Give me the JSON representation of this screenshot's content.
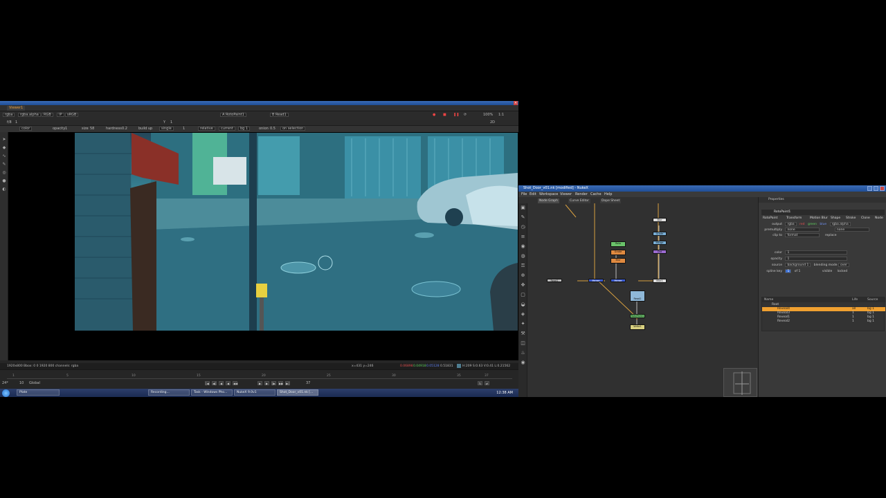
{
  "viewer_window": {
    "tab_label": "Viewer1",
    "channels": "rgba",
    "layer": "rgba.alpha",
    "colorspace": "RGB",
    "ip_label": "IP",
    "lut": "sRGB",
    "input_a": "A  RotoPaint1",
    "input_b": "B  Read1",
    "zoom": "100%",
    "proxy": "1:1",
    "view_mode": "2D",
    "frame_label": "f/8",
    "frame_value": "1",
    "y_label": "Y",
    "y_value": "1",
    "tool_options": {
      "color_label": "color",
      "opacity_label": "opacity",
      "opacity_value": "1",
      "size_label": "size",
      "size_value": "58",
      "hardness_label": "hardness",
      "hardness_value": "0.2",
      "buildup_label": "build up",
      "lifetime": "single",
      "lifetime_value": "1",
      "source_mode": "relative",
      "source": "current",
      "bg": "bg 1",
      "onion_label": "onion",
      "onion_value": "0.5",
      "selection": "on selection"
    },
    "status_left": "1920x800  Bbox: 0 0 1920 800 channels: rgba",
    "status_mid": "x=431 y=246",
    "status_red": "0.06898",
    "status_green": "0.04918",
    "status_blue": "0.05128",
    "status_alpha": "0.51831",
    "status_hsvl": "H:209 S:0.63 V:0.41  L:0.21562",
    "timeline_ticks": [
      "1",
      "5",
      "10",
      "15",
      "20",
      "25",
      "30",
      "35",
      "37"
    ],
    "fps": "24*",
    "frame_step": "10",
    "scope": "Global",
    "end_frame": "37"
  },
  "taskbar": {
    "items": [
      {
        "label": "Plate",
        "active": false
      },
      {
        "label": "Recording...",
        "active": false
      },
      {
        "label": "Task - Windows Pho...",
        "active": false
      },
      {
        "label": "NukeX 9.0v1",
        "active": false
      },
      {
        "label": "Shot_Door_v01.nk [...",
        "active": true
      }
    ],
    "clock": "12:38 AM"
  },
  "nuke_window": {
    "title": "Shot_Door_v01.nk [modified] - NukeX",
    "menu": [
      "File",
      "Edit",
      "Workspace",
      "Viewer",
      "Render",
      "Cache",
      "Help"
    ],
    "graph_tabs": [
      "Node Graph",
      "Curve Editor",
      "Dope Sheet"
    ],
    "nodes": [
      {
        "label": "Blur",
        "color": "#e0e0e0"
      },
      {
        "label": "Grade",
        "color": "#7ab0d8"
      },
      {
        "label": "Merge",
        "color": "#7ab0d8"
      },
      {
        "label": "Roto",
        "color": "#6ac26a"
      },
      {
        "label": "Grade",
        "color": "#e08a40"
      },
      {
        "label": "Blur",
        "color": "#e08a40"
      },
      {
        "label": "Dot",
        "color": "#9b6bd0"
      },
      {
        "label": "Read1",
        "color": "#bcbcbc"
      },
      {
        "label": "Merge",
        "color": "#3b5bd0"
      },
      {
        "label": "Merge",
        "color": "#3b5bd0"
      },
      {
        "label": "Blur1",
        "color": "#e0e0e0"
      },
      {
        "label": "Read2",
        "color": "#8fb8d8"
      },
      {
        "label": "RotoPaint1",
        "color": "#6ac26a"
      },
      {
        "label": "Write1",
        "color": "#d8d080"
      }
    ]
  },
  "properties": {
    "header": "Properties",
    "node_name": "RotoPaint1",
    "subtabs": [
      "RotoPaint",
      "Transform",
      "Motion Blur",
      "Shape",
      "Stroke",
      "Clone",
      "Node"
    ],
    "output_label": "output",
    "output_value": "rgba",
    "output_channels": [
      "red",
      "green",
      "blue",
      "rgba.alpha"
    ],
    "premultiply_label": "premultiply",
    "premultiply_value": "none",
    "premultiply_right": "none",
    "clip_to_label": "clip to",
    "clip_to_value": "format",
    "replace_label": "replace",
    "color_label": "color",
    "color_value": "1",
    "opacity_label": "opacity",
    "opacity_value": "1",
    "source_label": "source",
    "source_value": "background 1",
    "blending_label": "blending mode",
    "blending_value": "over",
    "splinekey_label": "spline key",
    "splinekey_value": "1",
    "splinekey_of": "of 1",
    "visible_label": "visible",
    "locked_label": "locked",
    "tree_columns": [
      "Name",
      "Life",
      "Source"
    ],
    "tree_root": "Root",
    "layers": [
      {
        "name": "Reveal4",
        "life": "all",
        "source": "bg 1",
        "selected": true
      },
      {
        "name": "Reveal3",
        "life": "1",
        "source": "bg 1",
        "selected": false
      },
      {
        "name": "Reveal1",
        "life": "1",
        "source": "bg 1",
        "selected": false
      },
      {
        "name": "Reveal2",
        "life": "1",
        "source": "bg 1",
        "selected": false
      }
    ]
  }
}
